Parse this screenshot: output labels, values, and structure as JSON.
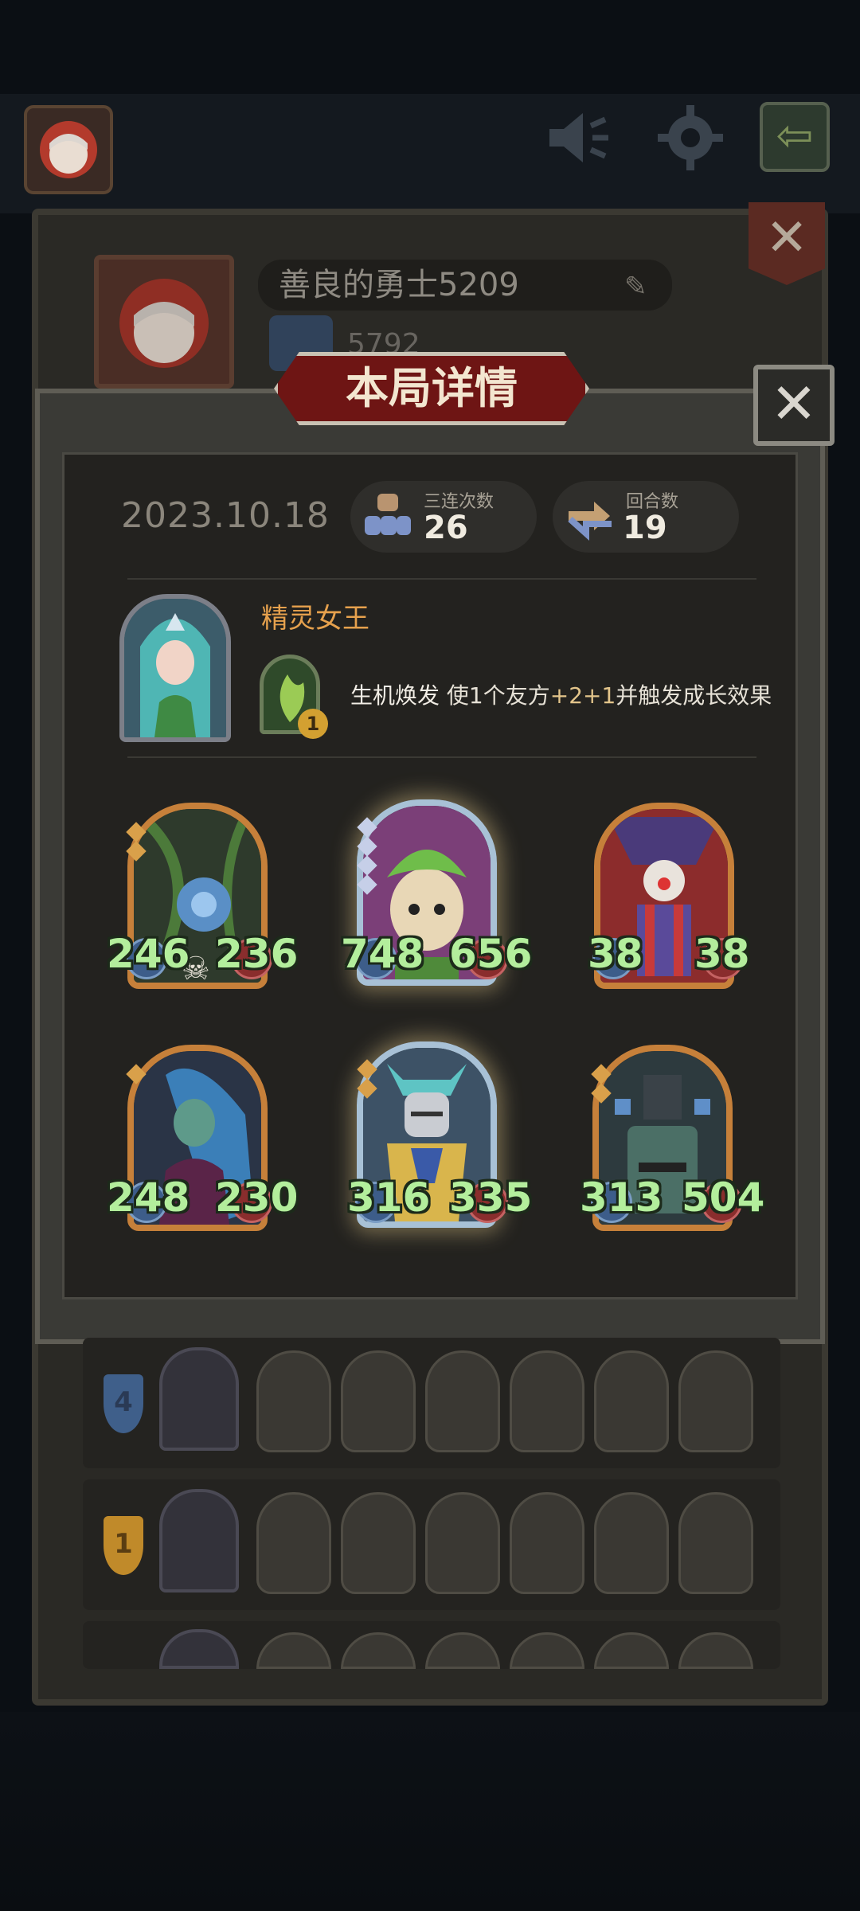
{
  "hud": {
    "icons": [
      "avatar-icon",
      "speaker-icon",
      "gear-icon",
      "back-arrow-icon"
    ]
  },
  "profile": {
    "player_name": "善良的勇士5209",
    "score": "5792"
  },
  "modal": {
    "title": "本局详情",
    "date": "2023.10.18",
    "triples_label": "三连次数",
    "triples_value": "26",
    "rounds_label": "回合数",
    "rounds_value": "19",
    "hero_name": "精灵女王",
    "skill_level": "1",
    "skill_name": "生机焕发",
    "skill_desc_before": " 使1个友方",
    "skill_desc_highlight": "+2+1",
    "skill_desc_after": "并触发成长效果"
  },
  "units": [
    {
      "name": "vine-flower",
      "attack": "246",
      "health": "236",
      "tier": "gold"
    },
    {
      "name": "sprout-kid",
      "attack": "748",
      "health": "656",
      "tier": "golden-frame"
    },
    {
      "name": "clown",
      "attack": "38",
      "health": "38",
      "tier": "gold"
    },
    {
      "name": "naga-sorceress",
      "attack": "248",
      "health": "230",
      "tier": "gold"
    },
    {
      "name": "paladin",
      "attack": "316",
      "health": "335",
      "tier": "golden-frame"
    },
    {
      "name": "iron-robot",
      "attack": "313",
      "health": "504",
      "tier": "gold"
    }
  ],
  "history": [
    {
      "rank": "4",
      "color": "#3f5f8a"
    },
    {
      "rank": "1",
      "color": "#c08a2a"
    },
    {
      "rank": "",
      "color": "#3f5f8a"
    }
  ],
  "colors": {
    "accent_red": "#6e1514",
    "stat_green": "#b3ee9c",
    "hero_name_orange": "#e6a14d",
    "frame_orange": "#c6803a"
  }
}
